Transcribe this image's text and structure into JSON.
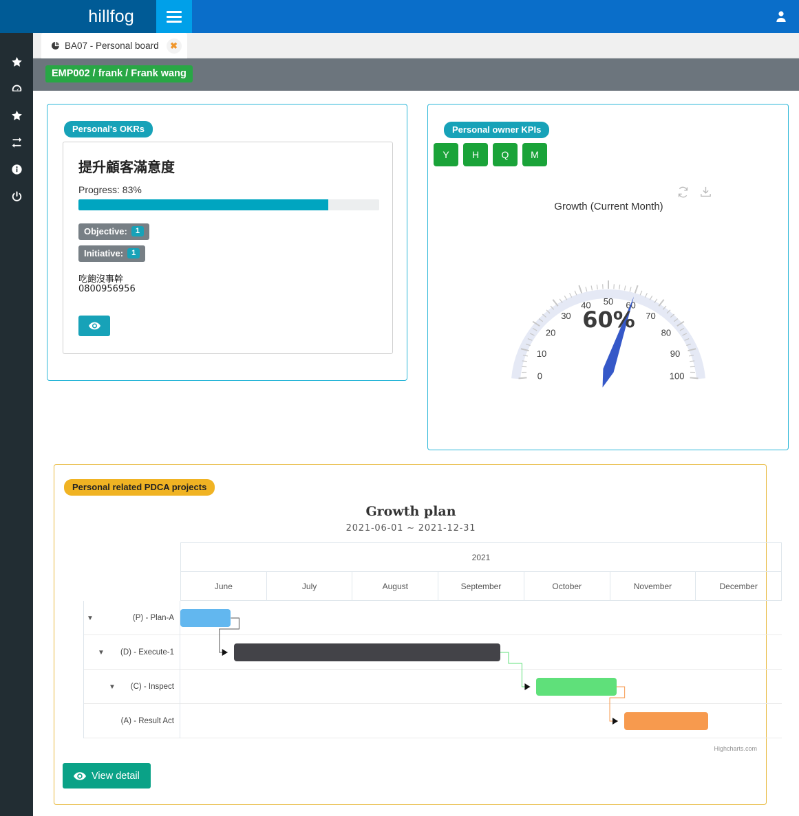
{
  "app": {
    "brand": "hillfog",
    "accent_blue": "#0a6ec9",
    "brand_dark": "#005b96",
    "hamburger_blue": "#00a0e9"
  },
  "sidebar": {
    "items": [
      {
        "icon": "star-icon",
        "name": "sidebar-item-favorites"
      },
      {
        "icon": "dashboard-icon",
        "name": "sidebar-item-dashboard"
      },
      {
        "icon": "star-icon",
        "name": "sidebar-item-starred"
      },
      {
        "icon": "exchange-icon",
        "name": "sidebar-item-exchange"
      },
      {
        "icon": "info-icon",
        "name": "sidebar-item-info"
      },
      {
        "icon": "power-icon",
        "name": "sidebar-item-logout"
      }
    ]
  },
  "tabs": [
    {
      "label": "BA07 - Personal board",
      "icon": "pie-chart-icon",
      "close": "✖",
      "active": true
    }
  ],
  "employee": {
    "badge": "EMP002 / frank / Frank wang",
    "badge_color": "#28a745"
  },
  "okr": {
    "badge": "Personal's OKRs",
    "title": "提升顧客滿意度",
    "progress_label": "Progress: 83%",
    "progress_percent": 83,
    "objective_label": "Objective:",
    "objective_count": "1",
    "initiative_label": "Initiative:",
    "initiative_count": "1",
    "note_line1": "吃飽沒事幹",
    "note_line2": "0800956956",
    "view_icon": "eye-icon",
    "accent": "#17a2b8",
    "bar_color": "#00a5c0"
  },
  "kpi": {
    "badge": "Personal owner KPIs",
    "period_buttons": [
      "Y",
      "H",
      "Q",
      "M"
    ],
    "period_color": "#1aa339",
    "tools": [
      {
        "name": "refresh-icon"
      },
      {
        "name": "download-icon"
      }
    ],
    "chart_data": {
      "type": "gauge",
      "title": "Growth (Current Month)",
      "value": 60,
      "value_label": "60%",
      "min": 0,
      "max": 100,
      "tick_labels": [
        0,
        10,
        20,
        30,
        40,
        50,
        60,
        70,
        80,
        90,
        100
      ],
      "needle_color": "#3558c8",
      "band_color": "#e5e9f5",
      "ylabel": "",
      "xlabel": ""
    }
  },
  "pdca": {
    "badge": "Personal related PDCA projects",
    "badge_color": "#f0b323",
    "view_detail_label": "View detail",
    "view_detail_icon": "eye-icon",
    "credit": "Highcharts.com",
    "chart_data": {
      "type": "gantt",
      "title": "Growth plan",
      "subtitle": "2021-06-01 ~ 2021-12-31",
      "year": "2021",
      "categories": [
        "June",
        "July",
        "August",
        "September",
        "October",
        "November",
        "December"
      ],
      "tasks": [
        {
          "name": "(P) - Plan-A",
          "indent": 0,
          "collapsible": true,
          "start_pct": 0.0,
          "end_pct": 8.4,
          "color": "#62b7ef"
        },
        {
          "name": "(D) - Execute-1",
          "indent": 1,
          "collapsible": true,
          "start_pct": 8.9,
          "end_pct": 53.2,
          "color": "#434348"
        },
        {
          "name": "(C) - Inspect",
          "indent": 2,
          "collapsible": true,
          "start_pct": 59.2,
          "end_pct": 72.5,
          "color": "#5fe07a"
        },
        {
          "name": "(A) - Result Act",
          "indent": 3,
          "collapsible": false,
          "start_pct": 73.8,
          "end_pct": 87.8,
          "color": "#f79a4e"
        }
      ],
      "dependencies": [
        {
          "from": "(P) - Plan-A",
          "to": "(D) - Execute-1",
          "color": "#555555"
        },
        {
          "from": "(D) - Execute-1",
          "to": "(C) - Inspect",
          "color": "#5fe07a"
        },
        {
          "from": "(C) - Inspect",
          "to": "(A) - Result Act",
          "color": "#f79a4e"
        }
      ]
    }
  }
}
